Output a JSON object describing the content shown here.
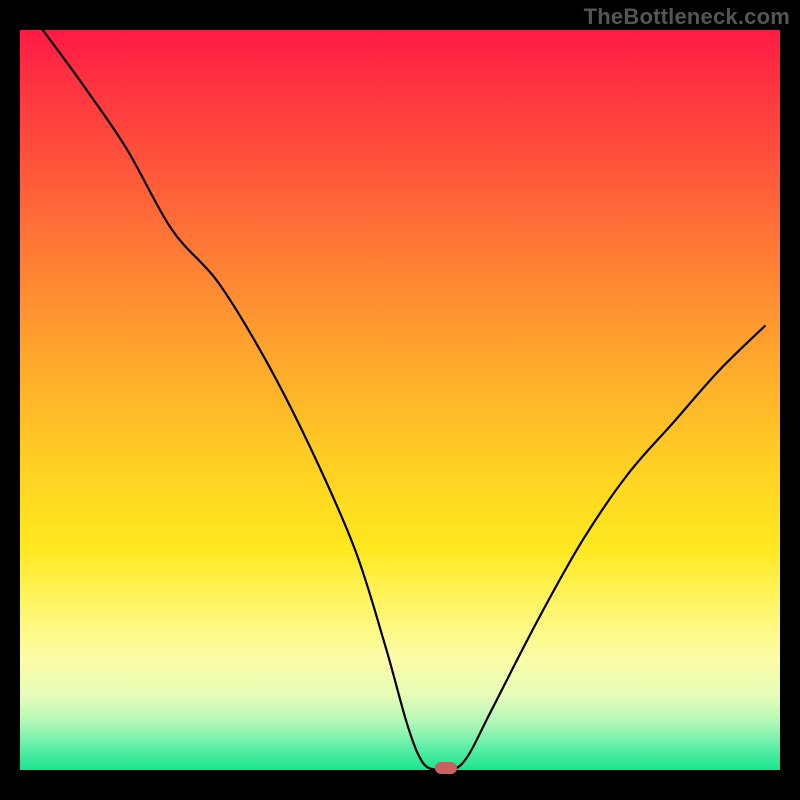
{
  "attribution": "TheBottleneck.com",
  "colors": {
    "marker_fill": "#c9615f",
    "curve_stroke": "#000000"
  },
  "chart_data": {
    "type": "line",
    "title": "",
    "xlabel": "",
    "ylabel": "",
    "xlim": [
      0,
      100
    ],
    "ylim": [
      0,
      100
    ],
    "x": [
      3,
      8,
      14,
      20,
      26,
      32,
      38,
      44,
      48,
      51,
      53,
      55,
      57,
      59,
      62,
      68,
      74,
      80,
      86,
      92,
      98
    ],
    "values": [
      100,
      93,
      84,
      73,
      66,
      56,
      44,
      30,
      17,
      6,
      1,
      0,
      0,
      2,
      8,
      20,
      31,
      40,
      47,
      54,
      60
    ],
    "minimum_x": 56,
    "minimum_y": 0,
    "annotations": [
      {
        "type": "marker",
        "x": 56,
        "y": 0
      }
    ]
  }
}
